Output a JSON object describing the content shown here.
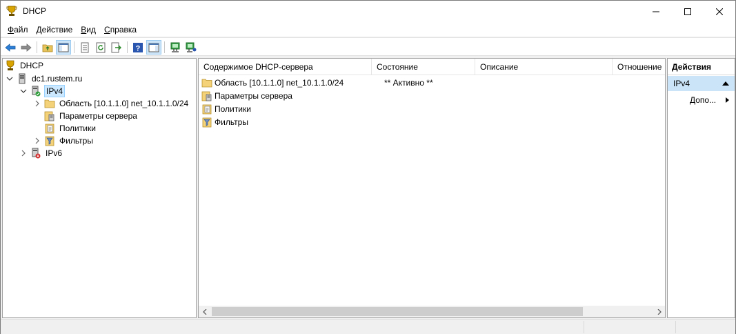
{
  "window": {
    "title": "DHCP",
    "minimize_glyph": "—",
    "maximize_glyph": "☐",
    "close_glyph": "✕"
  },
  "menu": {
    "items": [
      {
        "hotkey": "Ф",
        "rest": "айл"
      },
      {
        "hotkey": "Д",
        "rest": "ействие"
      },
      {
        "hotkey": "В",
        "rest": "ид"
      },
      {
        "hotkey": "С",
        "rest": "правка"
      }
    ]
  },
  "toolbar": {
    "buttons": [
      "back-icon",
      "forward-icon",
      "up-folder-icon",
      "show-hide-tree-icon",
      "properties-icon",
      "refresh-icon",
      "export-list-icon",
      "help-icon",
      "show-hide-action-pane-icon",
      "server-add-icon",
      "server-authorize-icon"
    ]
  },
  "tree": {
    "root": "DHCP",
    "server": "dc1.rustem.ru",
    "ipv4": "IPv4",
    "scope": "Область [10.1.1.0] net_10.1.1.0/24",
    "server_options": "Параметры сервера",
    "policies": "Политики",
    "filters": "Фильтры",
    "ipv6": "IPv6"
  },
  "list": {
    "columns": [
      "Содержимое DHCP-сервера",
      "Состояние",
      "Описание",
      "Отношение"
    ],
    "rows": [
      {
        "name": "Область [10.1.1.0] net_10.1.1.0/24",
        "state": "** Активно **",
        "icon": "folder-icon"
      },
      {
        "name": "Параметры сервера",
        "state": "",
        "icon": "server-options-icon"
      },
      {
        "name": "Политики",
        "state": "",
        "icon": "policies-icon"
      },
      {
        "name": "Фильтры",
        "state": "",
        "icon": "filters-icon"
      }
    ]
  },
  "actions": {
    "header": "Действия",
    "section": "IPv4",
    "more": "Допо..."
  },
  "colors": {
    "selection": "#cce8ff",
    "action_section": "#cce4f7"
  }
}
